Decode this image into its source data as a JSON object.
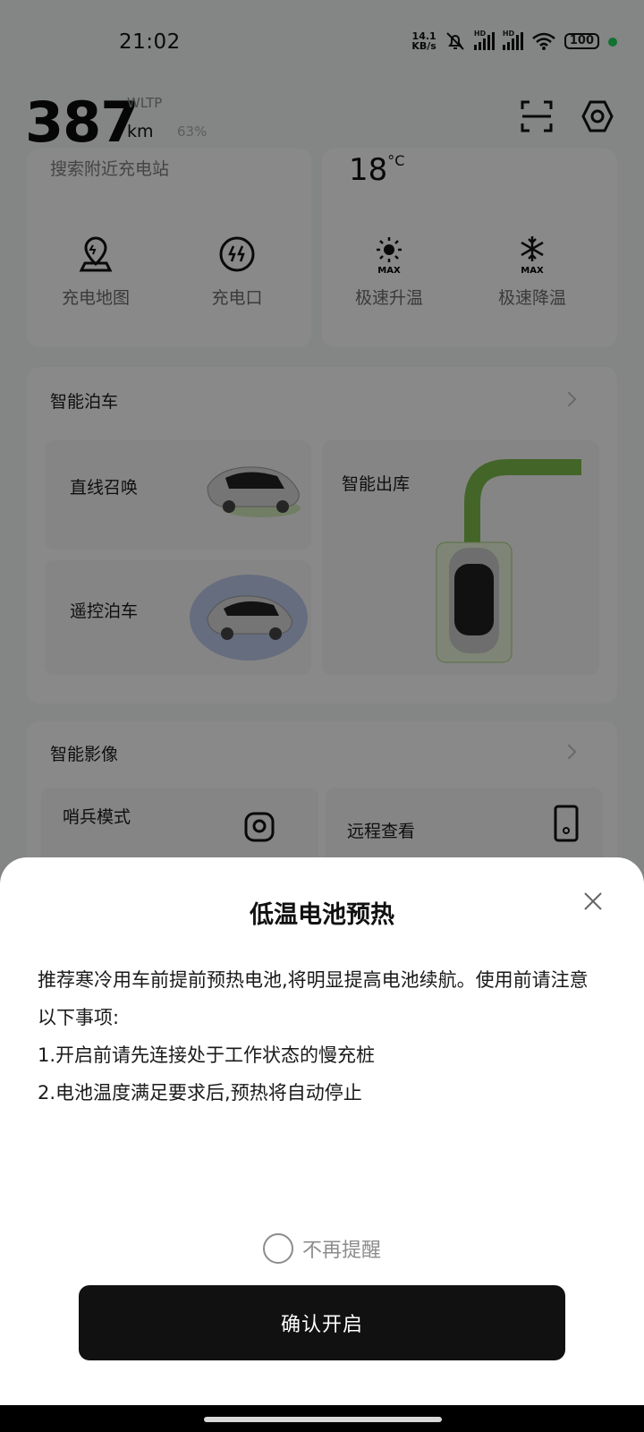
{
  "status_bar": {
    "time": "21:02",
    "net_speed_value": "14.1",
    "net_speed_unit": "KB/s",
    "sim1_label": "HD",
    "sim2_label": "HD",
    "battery": "100",
    "dot_color": "#1fd05a"
  },
  "header": {
    "range_value": "387",
    "range_standard": "WLTP",
    "range_unit": "km",
    "battery_percent": "63%"
  },
  "charging_card": {
    "search_label": "搜索附近充电站",
    "tools": [
      {
        "label": "充电地图",
        "icon": "map-pin-icon"
      },
      {
        "label": "充电口",
        "icon": "charge-port-icon"
      }
    ]
  },
  "climate_card": {
    "temperature": "18",
    "temperature_unit": "°C",
    "tools": [
      {
        "label": "极速升温",
        "icon": "sun-max-icon"
      },
      {
        "label": "极速降温",
        "icon": "snowflake-max-icon"
      }
    ],
    "max_badge": "MAX"
  },
  "parking_card": {
    "title": "智能泊车",
    "items": [
      {
        "label": "直线召唤"
      },
      {
        "label": "遥控泊车"
      },
      {
        "label": "智能出库"
      }
    ]
  },
  "camera_card": {
    "title": "智能影像",
    "items": [
      {
        "label": "哨兵模式"
      },
      {
        "label": "远程查看"
      }
    ]
  },
  "dialog": {
    "title": "低温电池预热",
    "body_line1": "推荐寒冷用车前提前预热电池,将明显提高电池续航。使用前请注意以下事项:",
    "body_line2": "1.开启前请先连接处于工作状态的慢充桩",
    "body_line3": "2.电池温度满足要求后,预热将自动停止",
    "dont_remind_label": "不再提醒",
    "confirm_label": "确认开启"
  }
}
